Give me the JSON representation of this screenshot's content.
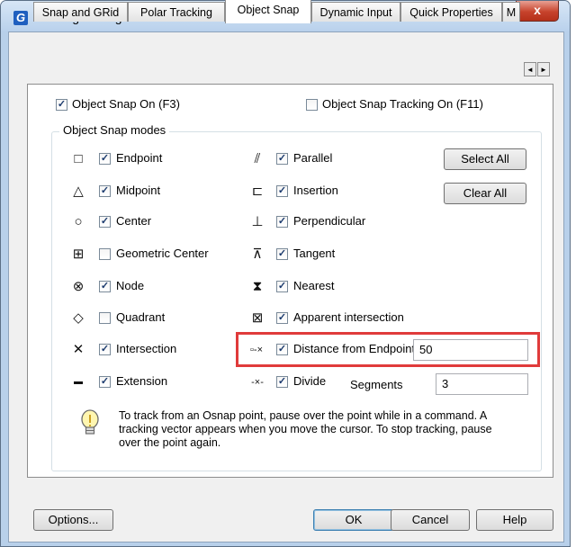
{
  "window": {
    "title": "Drafting Settings",
    "close_label": "x",
    "app_icon_letter": "G"
  },
  "tabs": [
    {
      "label": "Snap and GRid"
    },
    {
      "label": "Polar Tracking"
    },
    {
      "label": "Object Snap"
    },
    {
      "label": "Dynamic Input"
    },
    {
      "label": "Quick Properties"
    },
    {
      "label": "M"
    }
  ],
  "tab_scroll": {
    "left": "◄",
    "right": "►"
  },
  "options": {
    "object_snap_on": "Object Snap On (F3)",
    "object_snap_tracking_on": "Object Snap Tracking On (F11)"
  },
  "group_label": "Object Snap modes",
  "modes_left": [
    {
      "label": "Endpoint",
      "checked": true,
      "icon": "endpoint-icon",
      "glyph": "□"
    },
    {
      "label": "Midpoint",
      "checked": true,
      "icon": "midpoint-icon",
      "glyph": "△"
    },
    {
      "label": "Center",
      "checked": true,
      "icon": "center-icon",
      "glyph": "○"
    },
    {
      "label": "Geometric Center",
      "checked": false,
      "icon": "geometric-center-icon",
      "glyph": "⊞"
    },
    {
      "label": "Node",
      "checked": true,
      "icon": "node-icon",
      "glyph": "⊗"
    },
    {
      "label": "Quadrant",
      "checked": false,
      "icon": "quadrant-icon",
      "glyph": "◇"
    },
    {
      "label": "Intersection",
      "checked": true,
      "icon": "intersection-icon",
      "glyph": "✕"
    },
    {
      "label": "Extension",
      "checked": true,
      "icon": "extension-icon",
      "glyph": "▬"
    }
  ],
  "modes_right": [
    {
      "label": "Parallel",
      "checked": true,
      "icon": "parallel-icon",
      "glyph": "⫽"
    },
    {
      "label": "Insertion",
      "checked": true,
      "icon": "insertion-icon",
      "glyph": "⊏"
    },
    {
      "label": "Perpendicular",
      "checked": true,
      "icon": "perpendicular-icon",
      "glyph": "⊥"
    },
    {
      "label": "Tangent",
      "checked": true,
      "icon": "tangent-icon",
      "glyph": "⊼"
    },
    {
      "label": "Nearest",
      "checked": true,
      "icon": "nearest-icon",
      "glyph": "⧗"
    },
    {
      "label": "Apparent intersection",
      "checked": true,
      "icon": "apparent-intersection-icon",
      "glyph": "⊠"
    },
    {
      "label": "Distance from Endpoint",
      "checked": true,
      "icon": "distance-from-endpoint-icon",
      "glyph": "▫-×"
    },
    {
      "label": "Divide",
      "checked": true,
      "icon": "divide-icon",
      "glyph": "-×-"
    }
  ],
  "distance_value": "50",
  "segments_label": "Segments",
  "segments_value": "3",
  "buttons": {
    "select_all": "Select All",
    "clear_all": "Clear All",
    "options": "Options...",
    "ok": "OK",
    "cancel": "Cancel",
    "help": "Help"
  },
  "tip": "To track from an Osnap point, pause over the point while in a command.  A tracking vector appears when you move the cursor.  To stop tracking, pause over the point again."
}
